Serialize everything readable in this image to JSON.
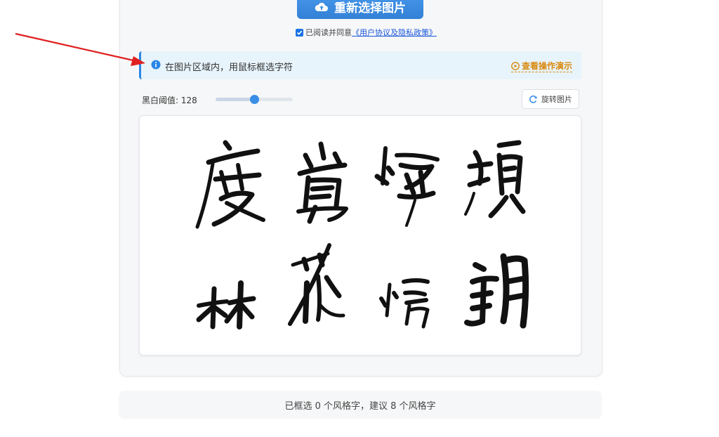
{
  "upload": {
    "reupload_label": "重新选择图片"
  },
  "agreement": {
    "prefix": "已阅读并同意",
    "link": "《用户协议及隐私政策》"
  },
  "tip": {
    "text": "在图片区域内，用鼠标框选字符",
    "demo_label": "查看操作演示"
  },
  "threshold": {
    "label": "黑白阈值: 128",
    "value": 128,
    "max": 255
  },
  "rotate": {
    "label": "旋转图片"
  },
  "status": {
    "text": "已框选 0 个风格字，建议 8 个风格字"
  },
  "colors": {
    "primary": "#3a8ee6",
    "tip_bg": "#e8f4fc",
    "demo": "#d98a10",
    "annotation_arrow": "#e02020"
  },
  "icons": [
    "upload-icon",
    "info-icon",
    "play-circle-icon",
    "rotate-icon",
    "checkbox-checked-icon"
  ]
}
